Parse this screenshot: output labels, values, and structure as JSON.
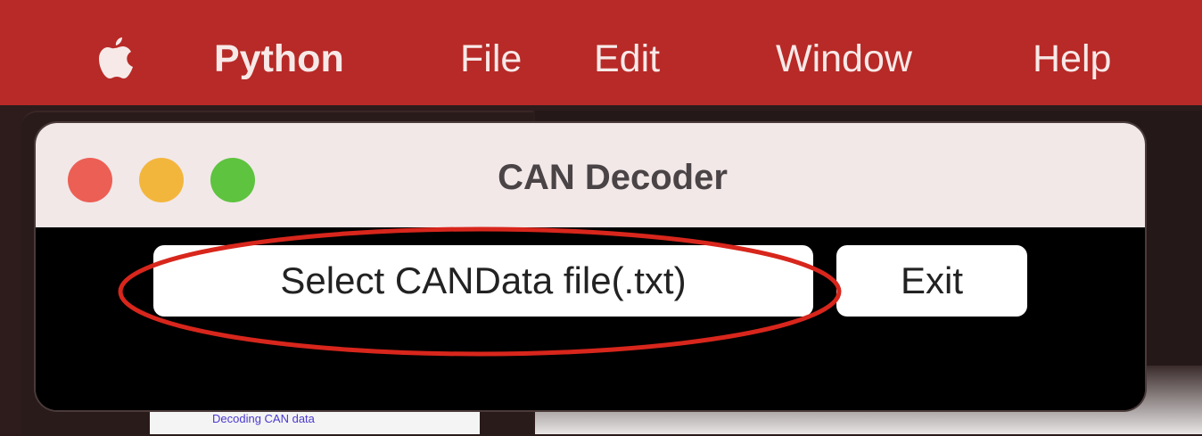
{
  "menubar": {
    "app_name": "Python",
    "items": [
      "File",
      "Edit",
      "Window",
      "Help"
    ]
  },
  "background": {
    "page_text": "Decoding CAN data"
  },
  "window": {
    "title": "CAN Decoder",
    "buttons": {
      "select_label": "Select CANData file(.txt)",
      "exit_label": "Exit"
    }
  },
  "colors": {
    "menubar": "#b72a27",
    "annotation": "#d8261c",
    "close": "#ec5f55",
    "minimize": "#f3b63d",
    "maximize": "#5ec33f"
  },
  "icons": {
    "apple": "apple-logo-icon"
  }
}
